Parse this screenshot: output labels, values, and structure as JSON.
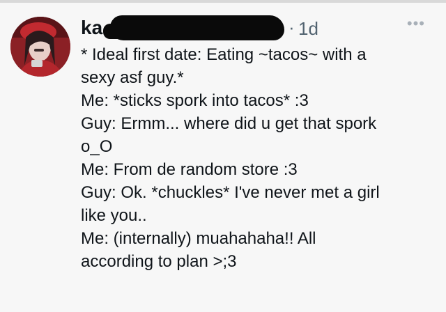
{
  "post": {
    "author_visible": "ka",
    "dot": "·",
    "time": "1d",
    "more": "•••",
    "lines": [
      "* Ideal first date: Eating ~tacos~ with a",
      "sexy asf guy.*",
      "Me: *sticks spork into tacos* :3",
      "Guy: Ermm... where did u get that spork",
      "o_O",
      "Me: From de random store :3",
      "Guy: Ok. *chuckles* I've never met a girl",
      "like you..",
      "Me: (internally) muahahaha!! All",
      "according to plan >;3"
    ]
  },
  "colors": {
    "background": "#f7f7f7",
    "text": "#0f1419",
    "muted": "#536471",
    "redaction": "#0a0a0a"
  }
}
